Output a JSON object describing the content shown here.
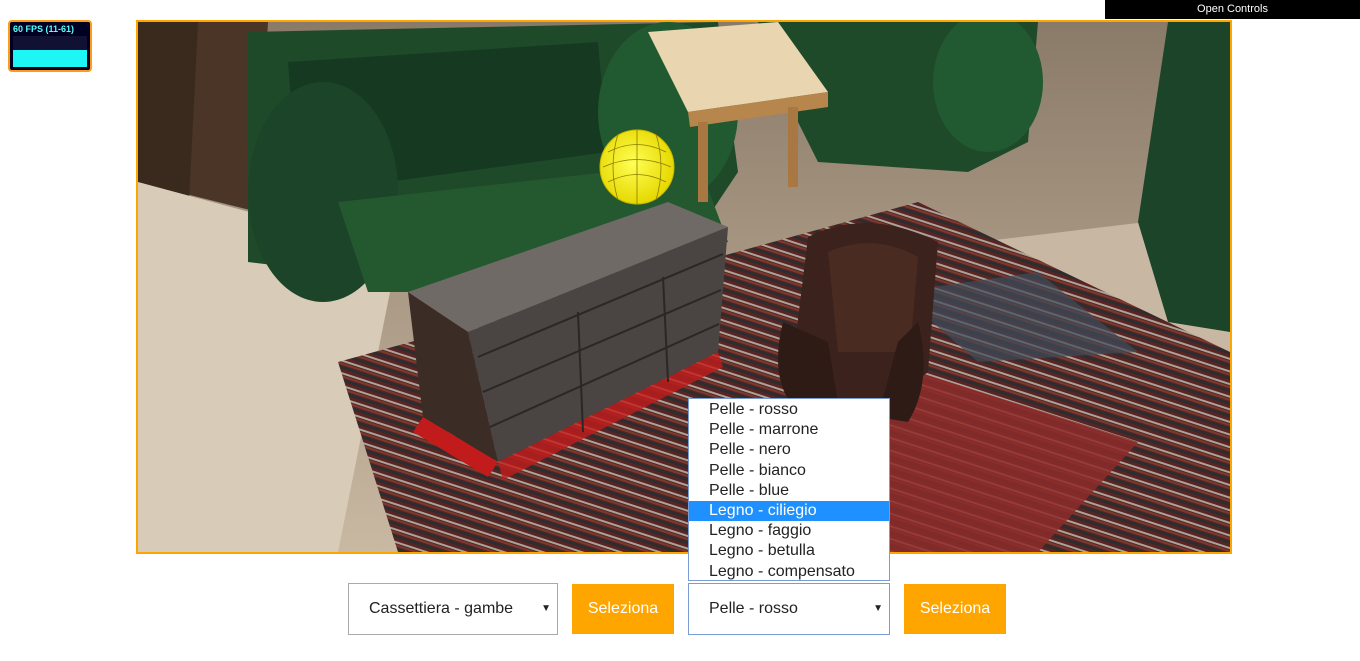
{
  "stats": {
    "fps_label": "60 FPS (11-61)"
  },
  "controls": {
    "open_label": "Open Controls"
  },
  "scene": {
    "accent_color": "#ffa500",
    "objects": [
      "armchair-green",
      "side-table",
      "dresser",
      "leather-chair",
      "rug",
      "light-gizmo"
    ]
  },
  "furniture_select": {
    "value": "Cassettiera - gambe",
    "button_label": "Seleziona"
  },
  "material_select": {
    "value": "Pelle - rosso",
    "button_label": "Seleziona",
    "options": [
      {
        "label": "Pelle - rosso"
      },
      {
        "label": "Pelle - marrone"
      },
      {
        "label": "Pelle - nero"
      },
      {
        "label": "Pelle - bianco"
      },
      {
        "label": "Pelle - blue"
      },
      {
        "label": "Legno - ciliegio"
      },
      {
        "label": "Legno - faggio"
      },
      {
        "label": "Legno - betulla"
      },
      {
        "label": "Legno - compensato"
      }
    ],
    "highlighted_index": 5
  }
}
